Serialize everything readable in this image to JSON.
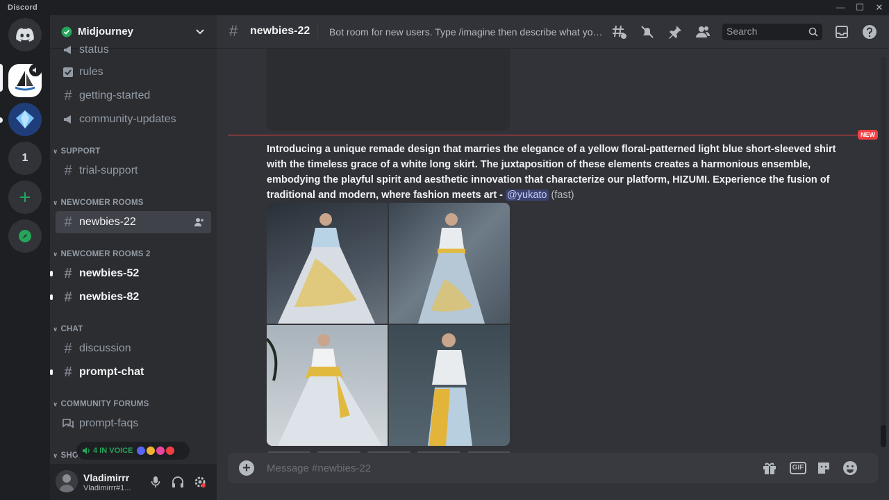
{
  "app": {
    "brand": "Discord"
  },
  "window": {
    "minimize": "—",
    "maximize": "☐",
    "close": "✕"
  },
  "servers": {
    "folder_count": "1"
  },
  "guild": {
    "name": "Midjourney"
  },
  "channels": {
    "status": "status",
    "rules": "rules",
    "getting_started": "getting-started",
    "community_updates": "community-updates",
    "cat_support": "SUPPORT",
    "trial_support": "trial-support",
    "cat_newcomer": "NEWCOMER ROOMS",
    "newbies_22": "newbies-22",
    "cat_newcomer2": "NEWCOMER ROOMS 2",
    "newbies_52": "newbies-52",
    "newbies_82": "newbies-82",
    "cat_chat": "CHAT",
    "discussion": "discussion",
    "prompt_chat": "prompt-chat",
    "cat_forums": "COMMUNITY FORUMS",
    "prompt_faqs": "prompt-faqs",
    "cat_showcase": "SHO..."
  },
  "voice": {
    "label": "4 IN VOICE"
  },
  "user": {
    "name": "Vladimirrr",
    "tag": "Vladimirrr#1..."
  },
  "topbar": {
    "channel": "newbies-22",
    "topic": "Bot room for new users. Type /imagine then describe what you w...",
    "search_placeholder": "Search"
  },
  "message": {
    "new_badge": "NEW",
    "text": "Introducing a unique remade design that marries the elegance of a yellow floral-patterned light blue short-sleeved shirt with the timeless grace of a white long skirt. The juxtaposition of these elements creates a harmonious ensemble, embodying the playful spirit and aesthetic innovation that characterize our platform, HIZUMI. Experience the fusion of traditional and modern, where fashion meets art - ",
    "mention": "@yukato",
    "speed": "(fast)"
  },
  "composer": {
    "placeholder": "Message #newbies-22",
    "gif": "GIF"
  },
  "colors": {
    "accent": "#5865f2",
    "online": "#23a55a",
    "new_line": "#f23f43"
  }
}
